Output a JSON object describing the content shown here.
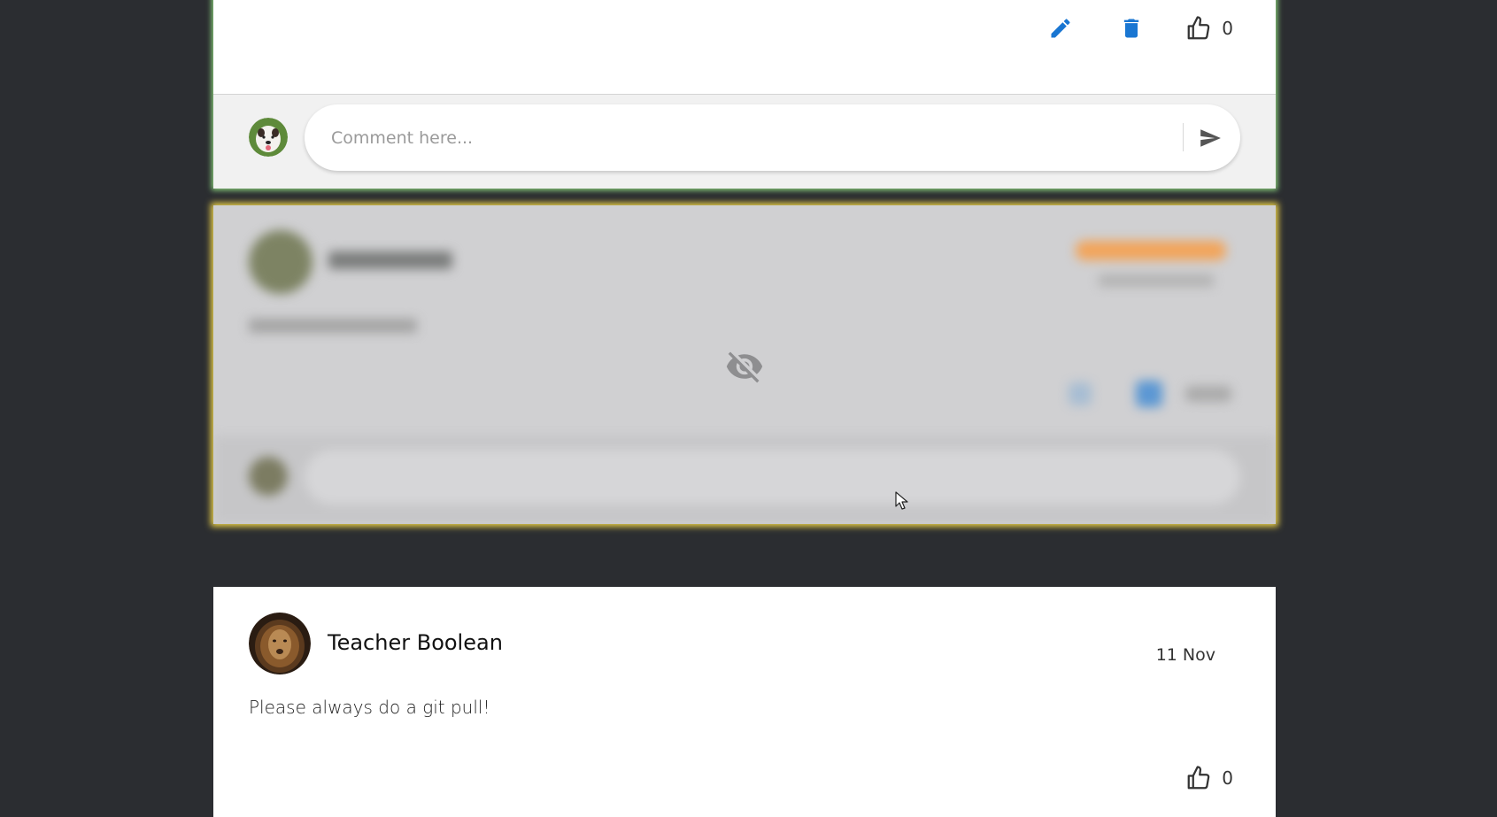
{
  "post1": {
    "like_count": "0",
    "comment_placeholder": "Comment here..."
  },
  "post2": {
    "hidden_icon": "eye-off-icon"
  },
  "post3": {
    "author": "Teacher Boolean",
    "date": "11 Nov",
    "body": "Please always do a git pull!",
    "like_count": "0"
  },
  "colors": {
    "background": "#2b2d31",
    "action_blue": "#1976d2",
    "post1_glow": "#8bd17c",
    "post2_glow": "#e8cf4a"
  }
}
